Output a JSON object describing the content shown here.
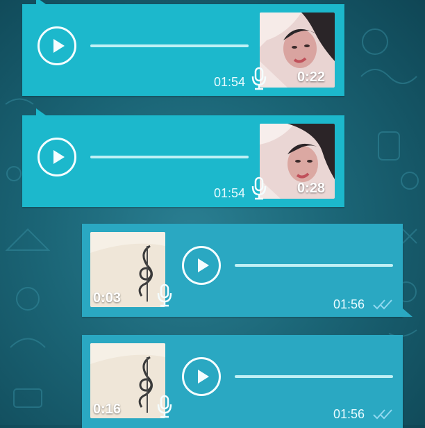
{
  "messages": [
    {
      "direction": "incoming",
      "time": "01:54",
      "duration": "0:22",
      "thumb": "photo",
      "status": ""
    },
    {
      "direction": "incoming",
      "time": "01:54",
      "duration": "0:28",
      "thumb": "photo",
      "status": ""
    },
    {
      "direction": "outgoing",
      "time": "01:56",
      "duration": "0:03",
      "thumb": "music-note",
      "status": "read"
    },
    {
      "direction": "outgoing",
      "time": "01:56",
      "duration": "0:16",
      "thumb": "music-note",
      "status": "read"
    }
  ],
  "icons": {
    "play": "play-icon",
    "mic": "microphone-icon",
    "read": "double-check-icon"
  },
  "colors": {
    "incoming_bubble": "#1cb8cc",
    "outgoing_bubble": "#2aa8c2",
    "wallpaper": "#1b6576",
    "ticks": "#8fd8ef"
  }
}
